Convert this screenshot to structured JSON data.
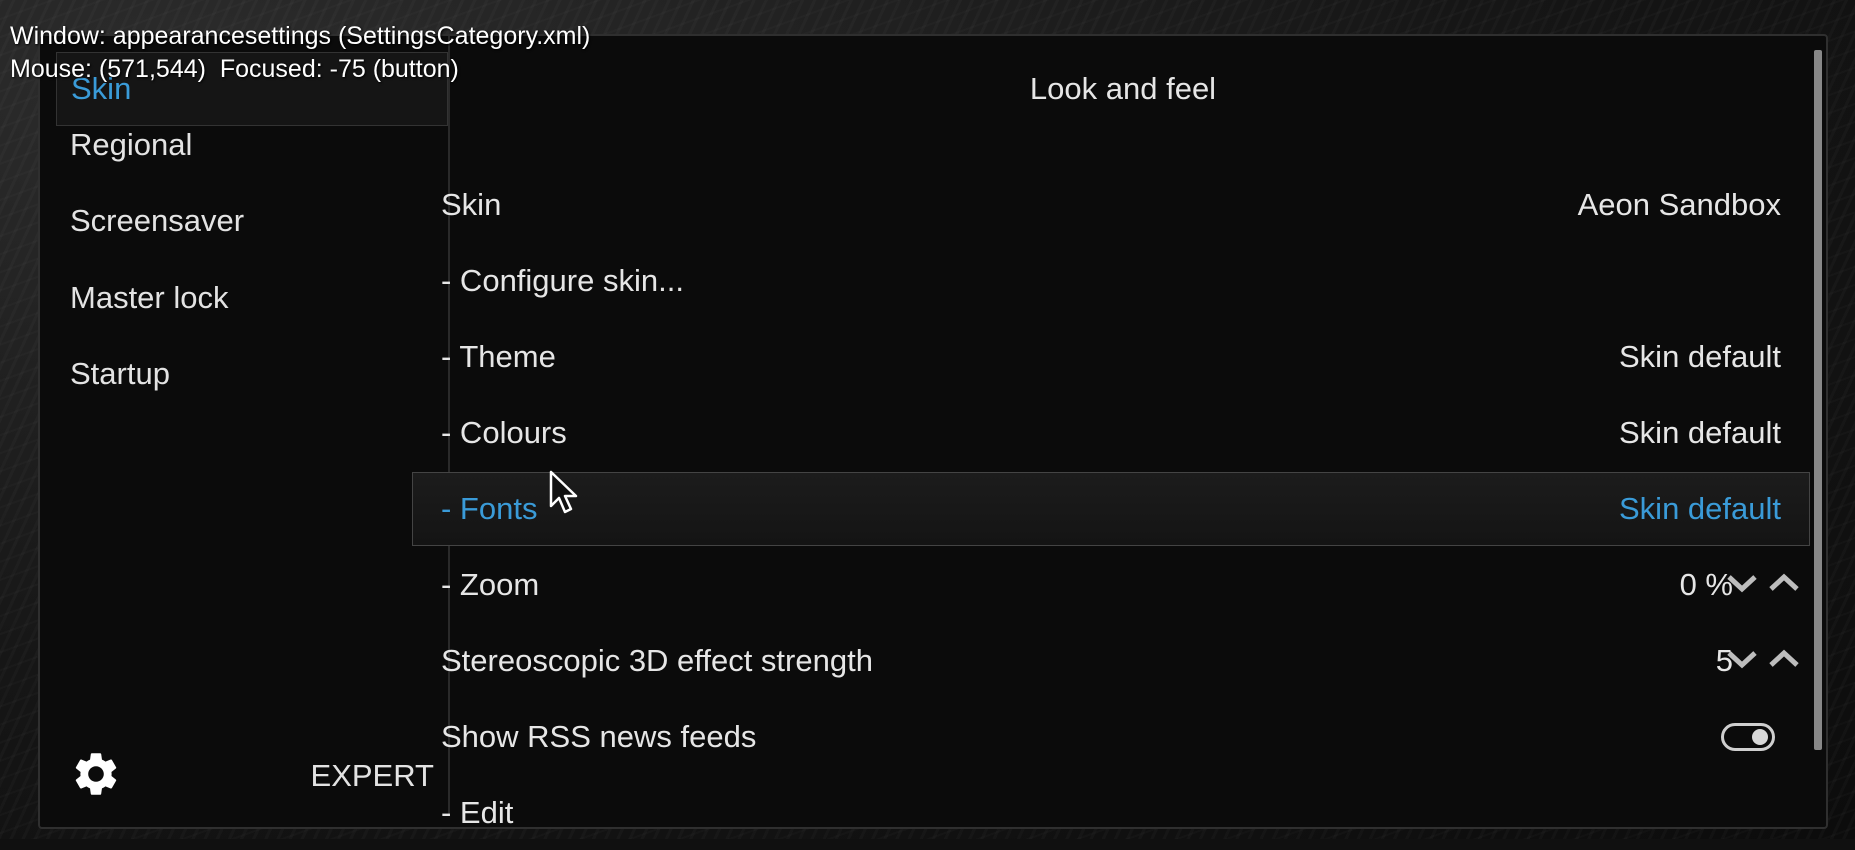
{
  "debug": {
    "line1": "Window: appearancesettings (SettingsCategory.xml)",
    "line2": "Mouse: (571,544)  Focused: -75 (button)"
  },
  "sidebar": {
    "items": [
      {
        "label": "Skin"
      },
      {
        "label": "Regional"
      },
      {
        "label": "Screensaver"
      },
      {
        "label": "Master lock"
      },
      {
        "label": "Startup"
      }
    ],
    "level_label": "EXPERT",
    "gear_icon": "gear-icon"
  },
  "main": {
    "heading": "Look and feel",
    "rows": [
      {
        "label": "Skin",
        "value": "Aeon Sandbox"
      },
      {
        "label": "- Configure skin...",
        "value": ""
      },
      {
        "label": "- Theme",
        "value": "Skin default"
      },
      {
        "label": "- Colours",
        "value": "Skin default"
      },
      {
        "label": "- Fonts",
        "value": "Skin default"
      },
      {
        "label": "- Zoom",
        "value": "0 %"
      },
      {
        "label": "Stereoscopic 3D effect strength",
        "value": "5"
      },
      {
        "label": "Show RSS news feeds",
        "value": ""
      },
      {
        "label": "- Edit",
        "value": ""
      }
    ],
    "rss_enabled": true
  },
  "colors": {
    "accent": "#3a9bd8",
    "background": "#0b0b0b"
  }
}
